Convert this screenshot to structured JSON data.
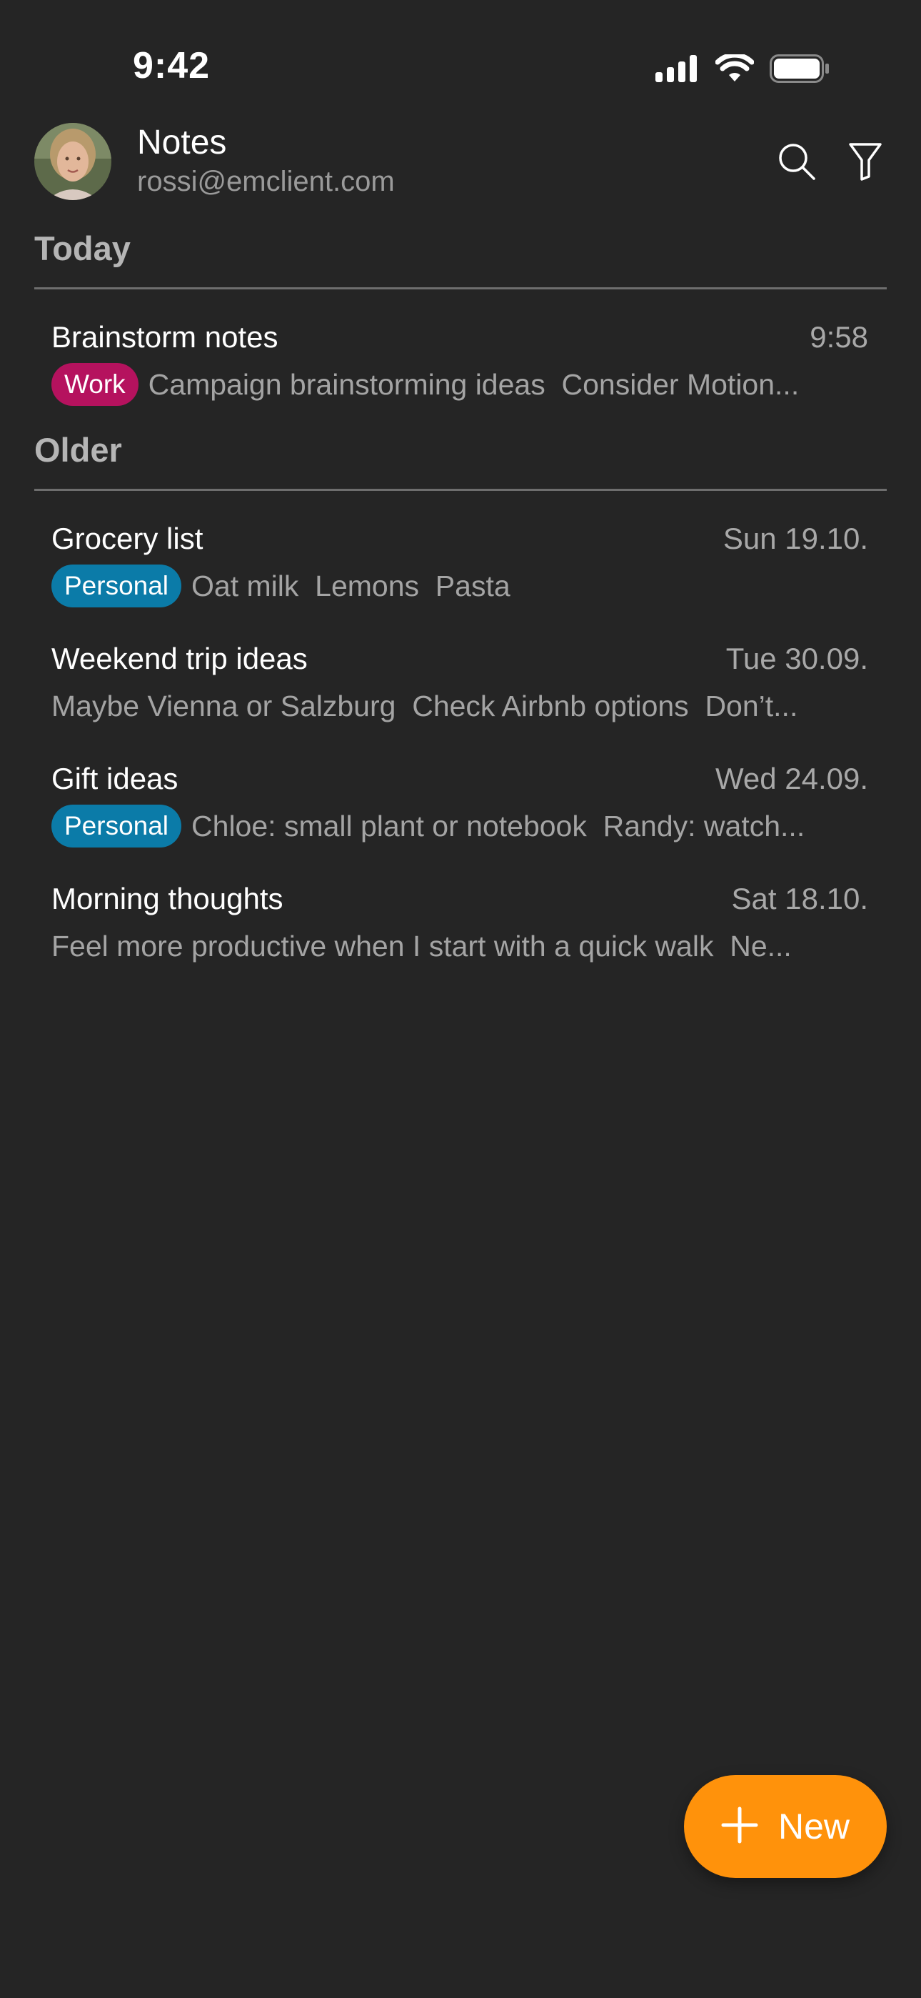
{
  "status_bar": {
    "time": "9:42"
  },
  "header": {
    "title": "Notes",
    "account": "rossi@emclient.com",
    "icons": [
      "search-icon",
      "filter-icon"
    ]
  },
  "sections": {
    "today": "Today",
    "older": "Older"
  },
  "notes": [
    {
      "title": "Brainstorm notes",
      "date": "9:58",
      "tag": "Work",
      "tag_color": "#b5125e",
      "preview": "Campaign brainstorming ideas  Consider Motion..."
    },
    {
      "title": "Grocery list",
      "date": "Sun 19.10.",
      "tag": "Personal",
      "tag_color": "#0b7ba8",
      "preview": "Oat milk  Lemons  Pasta"
    },
    {
      "title": "Weekend trip ideas",
      "date": "Tue 30.09.",
      "tag": "",
      "preview": "Maybe Vienna or Salzburg  Check Airbnb options  Don’t..."
    },
    {
      "title": "Gift ideas",
      "date": "Wed 24.09.",
      "tag": "Personal",
      "tag_color": "#0b7ba8",
      "preview": "Chloe: small plant or notebook  Randy: watch..."
    },
    {
      "title": "Morning thoughts",
      "date": "Sat 18.10.",
      "tag": "",
      "preview": "Feel more productive when I start with a quick walk  Ne..."
    }
  ],
  "fab": {
    "label": "New",
    "color": "#ff920b"
  }
}
